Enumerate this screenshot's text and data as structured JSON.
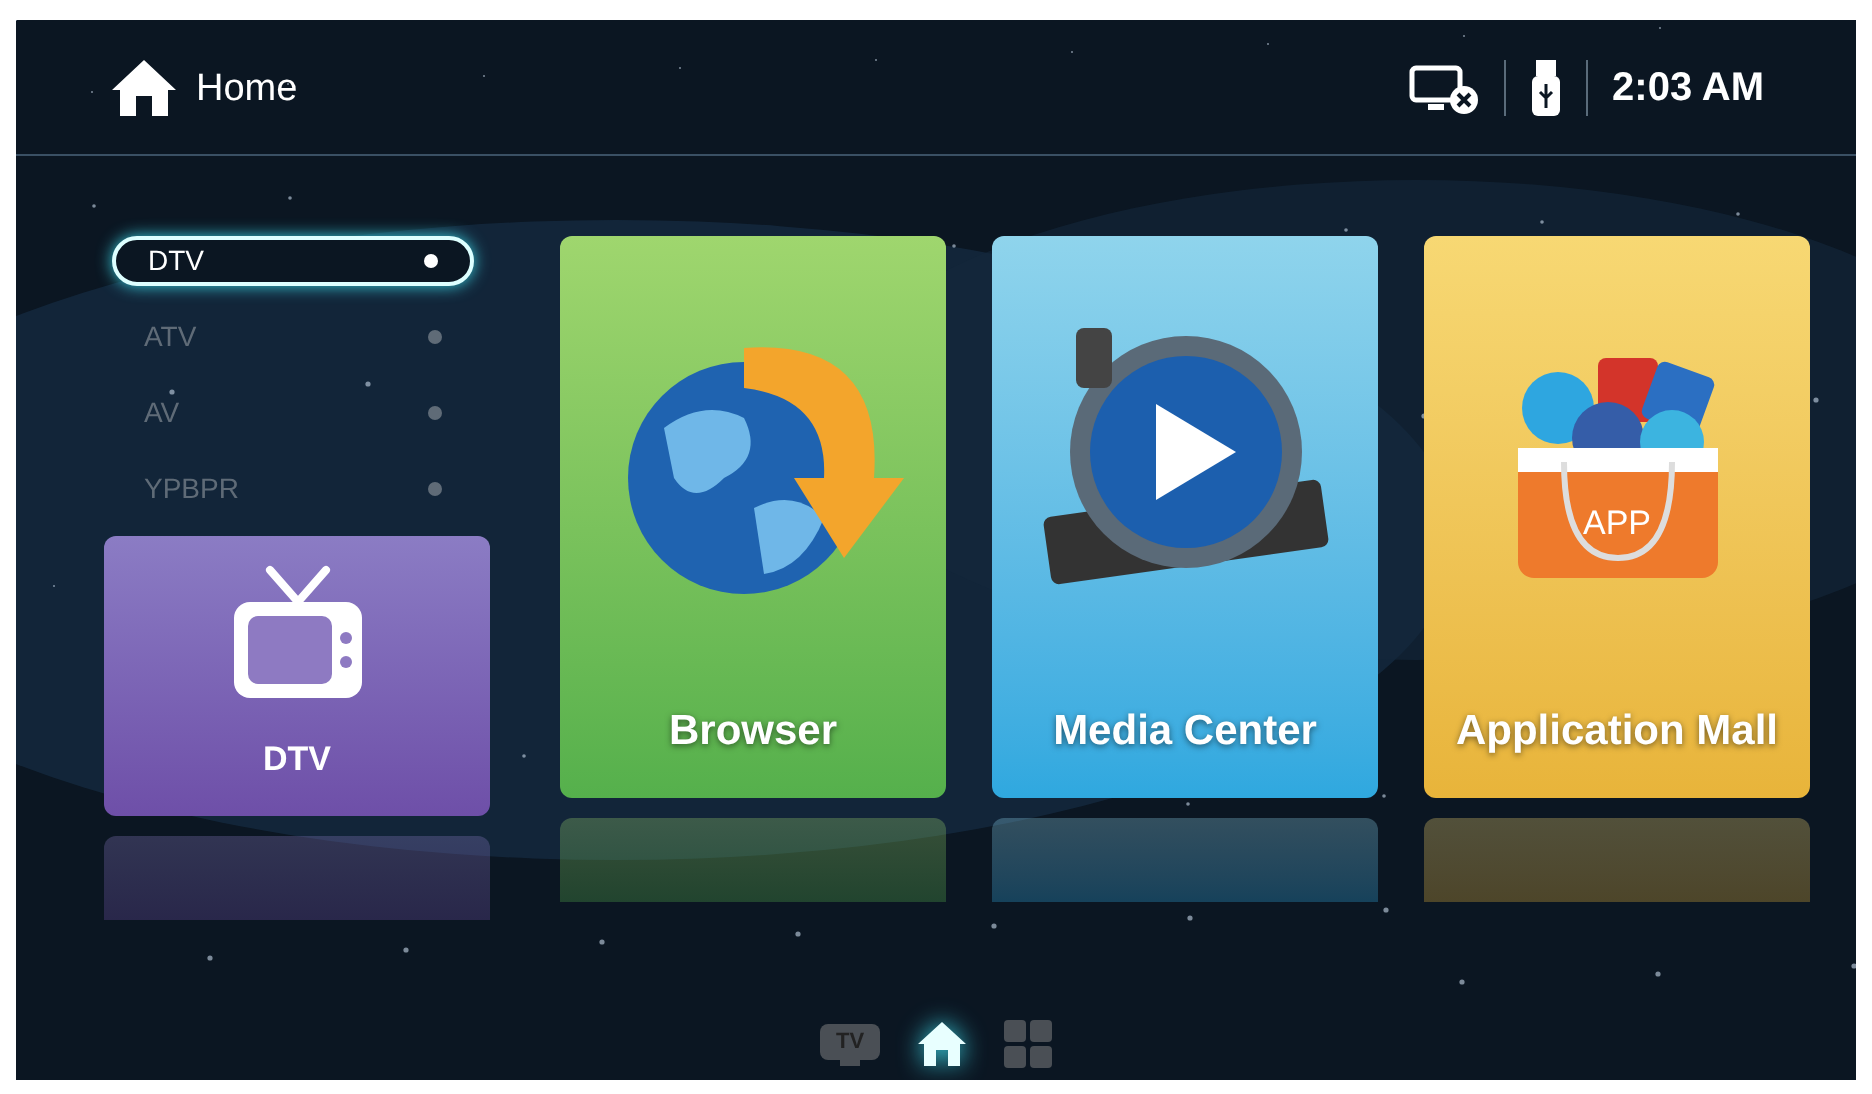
{
  "header": {
    "title": "Home",
    "time": "2:03 AM"
  },
  "sources": [
    {
      "label": "DTV",
      "selected": true
    },
    {
      "label": "ATV",
      "selected": false
    },
    {
      "label": "AV",
      "selected": false
    },
    {
      "label": "YPBPR",
      "selected": false
    }
  ],
  "cards": [
    {
      "kind": "tv",
      "label": "DTV"
    },
    {
      "kind": "browser",
      "label": "Browser"
    },
    {
      "kind": "media",
      "label": "Media Center"
    },
    {
      "kind": "apps",
      "label": "Application Mall",
      "badge": "APP"
    }
  ],
  "dock": [
    {
      "kind": "tv",
      "text": "TV",
      "selected": false
    },
    {
      "kind": "home",
      "selected": true
    },
    {
      "kind": "apps",
      "selected": false
    }
  ]
}
